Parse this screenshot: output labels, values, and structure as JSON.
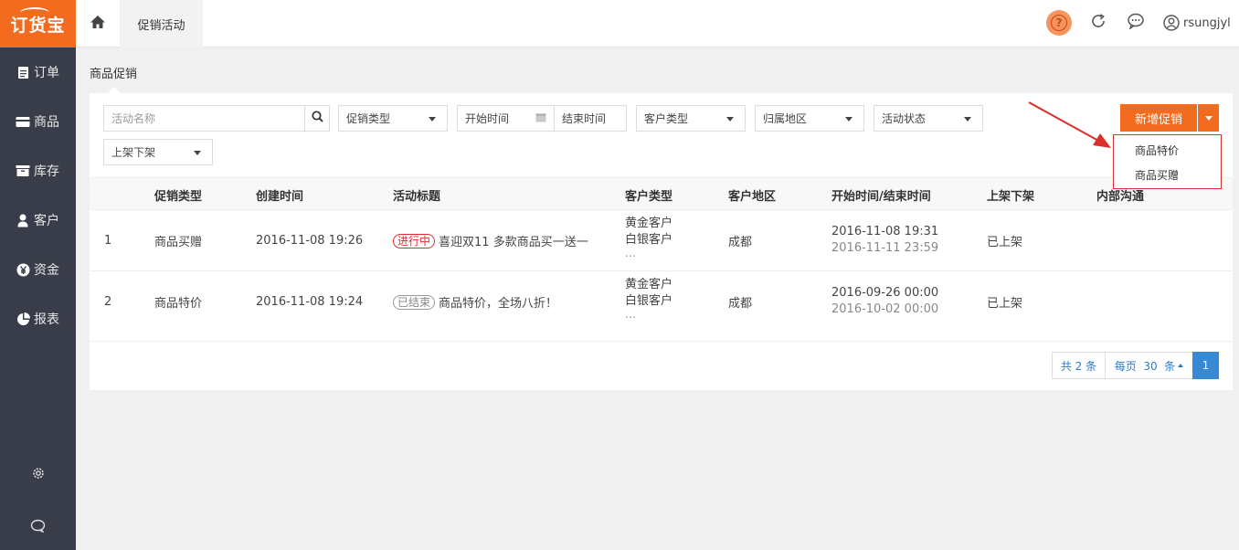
{
  "logo": {
    "text": "订货宝"
  },
  "sidebar": {
    "items": [
      {
        "label": "订单",
        "icon": "document-icon"
      },
      {
        "label": "商品",
        "icon": "goods-icon"
      },
      {
        "label": "库存",
        "icon": "inventory-icon"
      },
      {
        "label": "客户",
        "icon": "user-icon"
      },
      {
        "label": "资金",
        "icon": "yen-icon"
      },
      {
        "label": "报表",
        "icon": "pie-chart-icon"
      }
    ],
    "bottom_icons": [
      "gear-icon",
      "chat-icon"
    ]
  },
  "topbar": {
    "tab": "促销活动",
    "help_symbol": "?",
    "username": "rsungjyl"
  },
  "breadcrumb": "商品促销",
  "filters": {
    "activity_name_placeholder": "活动名称",
    "promo_type": "促销类型",
    "start_time": "开始时间",
    "end_time": "结束时间",
    "customer_type": "客户类型",
    "region": "归属地区",
    "activity_status": "活动状态",
    "shelf_status": "上架下架"
  },
  "new_button": {
    "label": "新增促销",
    "options": [
      "商品特价",
      "商品买赠"
    ]
  },
  "table": {
    "headers": [
      "促销类型",
      "创建时间",
      "活动标题",
      "客户类型",
      "客户地区",
      "开始时间/结束时间",
      "上架下架",
      "内部沟通"
    ],
    "rows": [
      {
        "index": "1",
        "type": "商品买赠",
        "created": "2016-11-08 19:26",
        "status_tag": "进行中",
        "title": "喜迎双11 多款商品买一送一",
        "customers": [
          "黄金客户",
          "白银客户",
          "..."
        ],
        "region": "成都",
        "start": "2016-11-08 19:31",
        "end": "2016-11-11 23:59",
        "shelf": "已上架"
      },
      {
        "index": "2",
        "type": "商品特价",
        "created": "2016-11-08 19:24",
        "status_tag": "已结束",
        "title": "商品特价，全场八折！",
        "customers": [
          "黄金客户",
          "白银客户",
          "..."
        ],
        "region": "成都",
        "start": "2016-09-26 00:00",
        "end": "2016-10-02 00:00",
        "shelf": "已上架"
      }
    ]
  },
  "pagination": {
    "total": "共 2 条",
    "per_page": "每页  30  条",
    "current": "1"
  },
  "colors": {
    "accent": "#f26b1f",
    "sidebar": "#393d49",
    "link": "#2d7bc5",
    "annotation": "#d9302c"
  }
}
